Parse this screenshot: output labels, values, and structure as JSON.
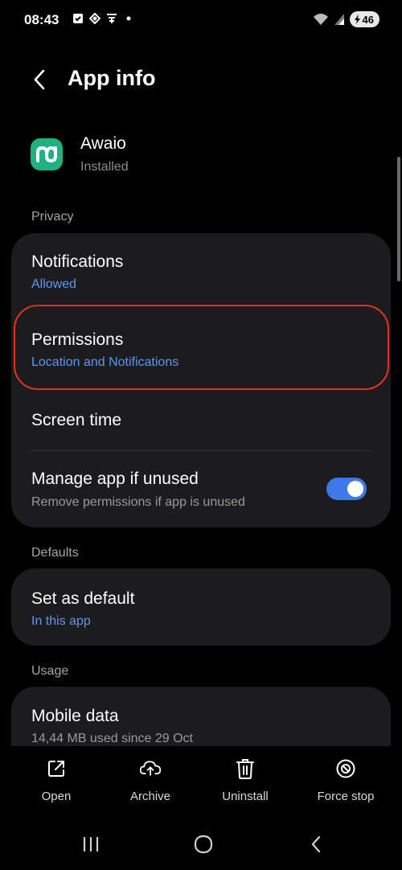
{
  "status_bar": {
    "time": "08:43",
    "battery": "46",
    "left_icons": [
      "checkbox-icon",
      "diamond-icon",
      "tray-icon",
      "dot-icon"
    ],
    "right_icons": [
      "wifi-icon",
      "signal-icon",
      "battery-icon"
    ]
  },
  "header": {
    "title": "App info"
  },
  "app": {
    "name": "Awaio",
    "status": "Installed",
    "icon_color": "#20b183"
  },
  "privacy": {
    "label": "Privacy",
    "notifications": {
      "title": "Notifications",
      "subtitle": "Allowed"
    },
    "permissions": {
      "title": "Permissions",
      "subtitle": "Location and Notifications"
    },
    "screen_time": {
      "title": "Screen time"
    },
    "manage_unused": {
      "title": "Manage app if unused",
      "subtitle": "Remove permissions if app is unused",
      "enabled": true
    }
  },
  "defaults": {
    "label": "Defaults",
    "set_default": {
      "title": "Set as default",
      "subtitle": "In this app"
    }
  },
  "usage": {
    "label": "Usage",
    "mobile_data": {
      "title": "Mobile data",
      "subtitle": "14,44 MB used since 29 Oct"
    }
  },
  "actions": {
    "open": "Open",
    "archive": "Archive",
    "uninstall": "Uninstall",
    "force_stop": "Force stop"
  },
  "colors": {
    "accent": "#5e96f0",
    "highlight": "#e2321f",
    "card": "#1c1c1e",
    "toggle_on": "#3d79e8"
  }
}
